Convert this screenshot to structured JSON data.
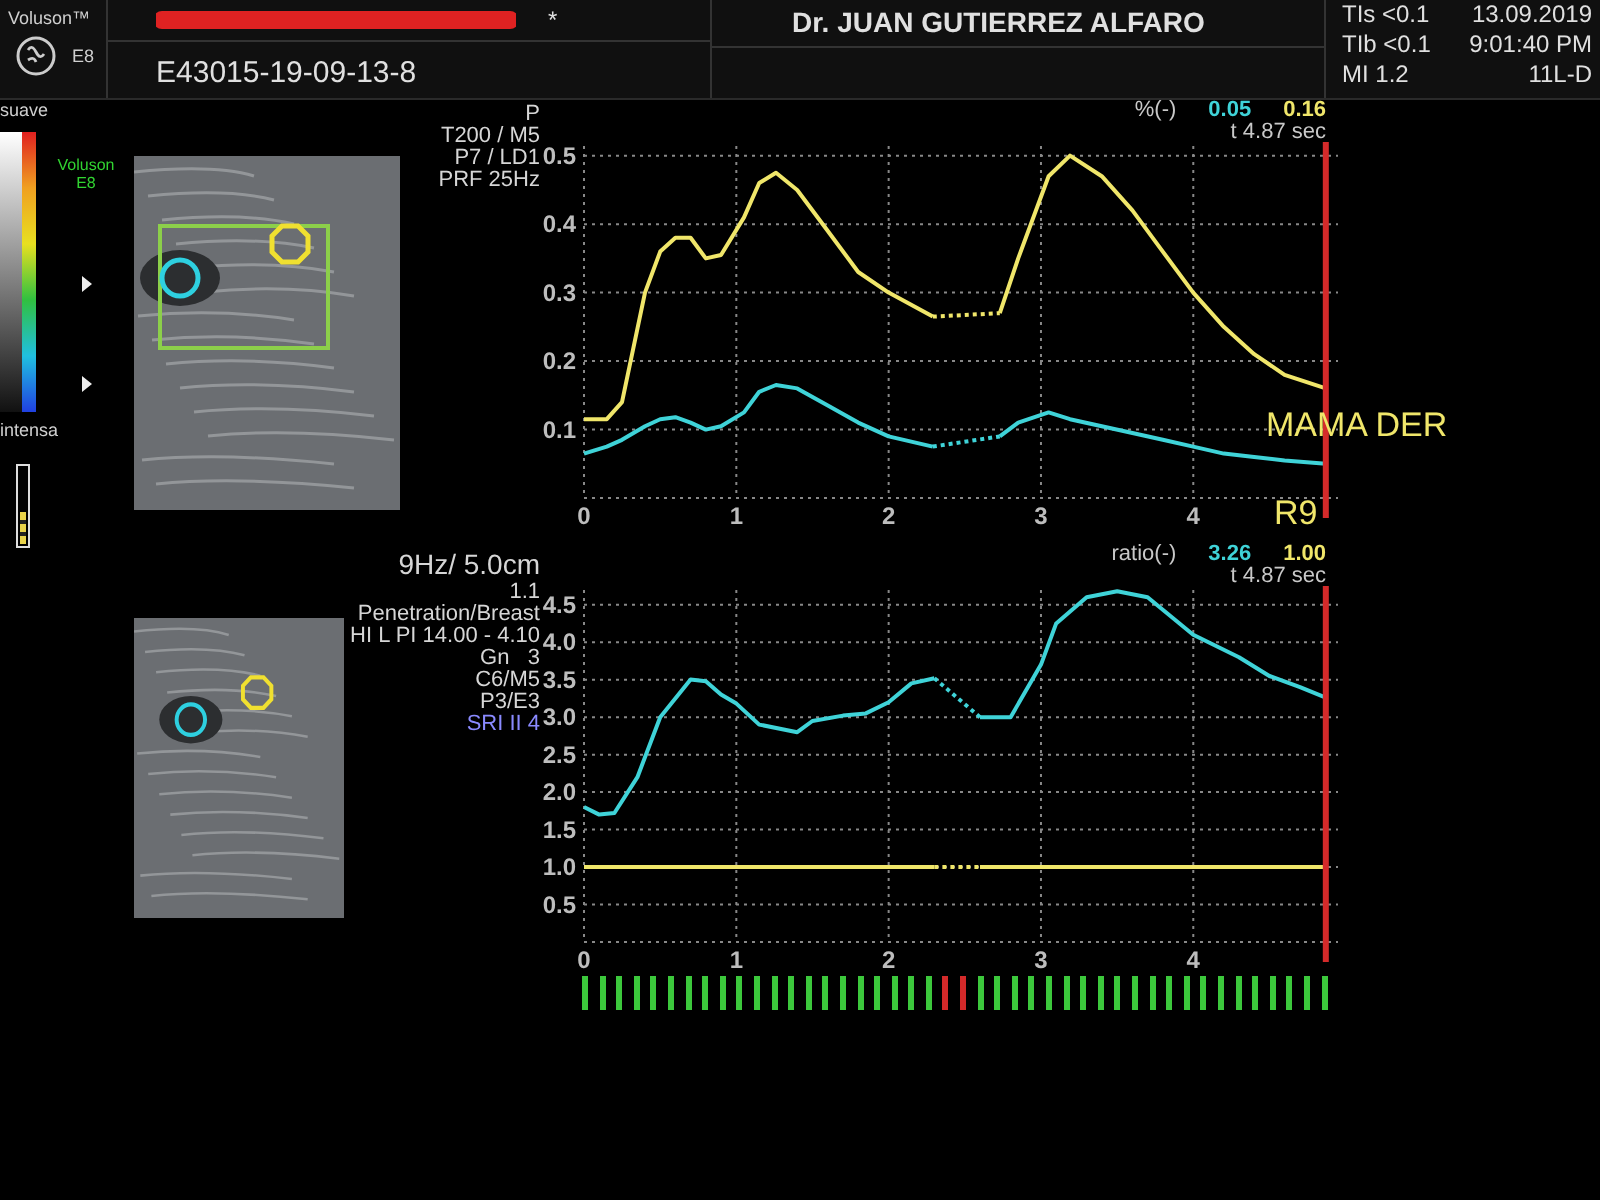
{
  "header": {
    "brand": "Voluson™",
    "model": "E8",
    "patient_flag": "*",
    "exam_id": "E43015-19-09-13-8",
    "doctor": "Dr. JUAN GUTIERREZ ALFARO",
    "safety": [
      "TIs <0.1",
      "TIb <0.1",
      "MI 1.2"
    ],
    "date": "13.09.2019",
    "time": "9:01:40 PM",
    "probe": "11L-D"
  },
  "color_scale": {
    "top_label": "suave",
    "bottom_label": "intensa",
    "brand_label": "Voluson",
    "model_label": "E8",
    "gauge": {
      "level": 0.4
    }
  },
  "panels": [
    {
      "image_params": [
        {
          "text": "P",
          "kind": "line",
          "color": "#d6d6d6"
        },
        {
          "text": "T200 / M5",
          "kind": "line",
          "color": "#d6d6d6"
        },
        {
          "text": "P7 / LD1",
          "kind": "line",
          "color": "#d6d6d6"
        },
        {
          "text": "PRF 25Hz",
          "kind": "line",
          "color": "#d6d6d6"
        }
      ],
      "readout": {
        "unit": "%(-)",
        "values": [
          {
            "text": "0.05",
            "color": "#3fd3d8"
          },
          {
            "text": "0.16",
            "color": "#f0e66a"
          }
        ],
        "time": "t 4.87 sec"
      },
      "labels": [
        {
          "text": "MAMA DER"
        },
        {
          "text": "R9"
        }
      ],
      "chart_data": {
        "type": "line",
        "x": [
          0,
          0.15,
          0.25,
          0.4,
          0.5,
          0.6,
          0.7,
          0.8,
          0.9,
          1.05,
          1.15,
          1.26,
          1.4,
          1.6,
          1.8,
          2.0,
          2.29,
          2.5,
          2.73,
          2.85,
          3.05,
          3.19,
          3.4,
          3.6,
          3.8,
          4.0,
          4.2,
          4.4,
          4.6,
          4.87
        ],
        "series": [
          {
            "color": "#f0e66a",
            "values": [
              0.115,
              0.115,
              0.14,
              0.3,
              0.36,
              0.38,
              0.38,
              0.35,
              0.355,
              0.41,
              0.46,
              0.475,
              0.45,
              0.39,
              0.33,
              0.3,
              0.265,
              null,
              0.27,
              0.35,
              0.47,
              0.5,
              0.47,
              0.42,
              0.36,
              0.3,
              0.25,
              0.21,
              0.18,
              0.16
            ]
          },
          {
            "color": "#3fd3d8",
            "values": [
              0.065,
              0.075,
              0.085,
              0.105,
              0.115,
              0.118,
              0.11,
              0.1,
              0.105,
              0.125,
              0.155,
              0.165,
              0.16,
              0.135,
              0.11,
              0.09,
              0.075,
              null,
              0.09,
              0.11,
              0.125,
              0.115,
              0.105,
              0.095,
              0.085,
              0.075,
              0.065,
              0.06,
              0.055,
              0.05
            ]
          }
        ],
        "xlim": [
          0,
          4.95
        ],
        "ylim": [
          0,
          0.52
        ],
        "xticks": [
          0,
          1,
          2,
          3,
          4
        ],
        "yticks": [
          0.1,
          0.2,
          0.3,
          0.4,
          0.5
        ],
        "grid": true,
        "ref_lines": [
          {
            "axis": "x",
            "value": 4.87,
            "color": "#d42a2a"
          }
        ]
      }
    },
    {
      "image_params": [
        {
          "text": "9Hz/ 5.0cm",
          "kind": "heading",
          "color": "#d6d6d6"
        },
        {
          "text": "1.1",
          "kind": "line",
          "color": "#d6d6d6"
        },
        {
          "text": "Penetration/Breast",
          "kind": "line",
          "color": "#d6d6d6"
        },
        {
          "text": "HI L PI 14.00 - 4.10",
          "kind": "line",
          "color": "#d6d6d6"
        },
        {
          "text": "Gn   3",
          "kind": "line",
          "color": "#d6d6d6"
        },
        {
          "text": "C6/M5",
          "kind": "line",
          "color": "#d6d6d6"
        },
        {
          "text": "P3/E3",
          "kind": "line",
          "color": "#d6d6d6"
        },
        {
          "text": "SRI II 4",
          "kind": "line",
          "color": "#8a8aff"
        }
      ],
      "readout": {
        "unit": "ratio(-)",
        "values": [
          {
            "text": "3.26",
            "color": "#3fd3d8"
          },
          {
            "text": "1.00",
            "color": "#f0e66a"
          }
        ],
        "time": "t 4.87 sec"
      },
      "chart_data": {
        "type": "line",
        "x": [
          0,
          0.1,
          0.2,
          0.35,
          0.5,
          0.7,
          0.8,
          0.9,
          1.0,
          1.15,
          1.4,
          1.5,
          1.7,
          1.85,
          2.0,
          2.15,
          2.3,
          2.45,
          2.6,
          2.8,
          3.0,
          3.1,
          3.3,
          3.5,
          3.7,
          4.0,
          4.3,
          4.5,
          4.7,
          4.87
        ],
        "series": [
          {
            "color": "#3fd3d8",
            "values": [
              1.8,
              1.7,
              1.72,
              2.2,
              3.0,
              3.5,
              3.48,
              3.3,
              3.18,
              2.9,
              2.8,
              2.95,
              3.02,
              3.05,
              3.2,
              3.45,
              3.52,
              null,
              3.0,
              3.0,
              3.7,
              4.25,
              4.6,
              4.68,
              4.6,
              4.1,
              3.8,
              3.55,
              3.4,
              3.26
            ]
          },
          {
            "color": "#f0e66a",
            "values": [
              1.0,
              1.0,
              1.0,
              1.0,
              1.0,
              1.0,
              1.0,
              1.0,
              1.0,
              1.0,
              1.0,
              1.0,
              1.0,
              1.0,
              1.0,
              1.0,
              1.0,
              null,
              1.0,
              1.0,
              1.0,
              1.0,
              1.0,
              1.0,
              1.0,
              1.0,
              1.0,
              1.0,
              1.0,
              1.0
            ]
          }
        ],
        "xlim": [
          0,
          4.95
        ],
        "ylim": [
          0,
          4.75
        ],
        "xticks": [
          0,
          1,
          2,
          3,
          4
        ],
        "yticks": [
          {
            "value": 0.5,
            "label": "0.5"
          },
          {
            "value": 1,
            "label": "1.0"
          },
          {
            "value": 1.5,
            "label": "1.5"
          },
          {
            "value": 2,
            "label": "2.0"
          },
          {
            "value": 2.5,
            "label": "2.5"
          },
          {
            "value": 3,
            "label": "3.0"
          },
          {
            "value": 3.5,
            "label": "3.5"
          },
          {
            "value": 4,
            "label": "4.0"
          },
          {
            "value": 4.5,
            "label": "4.5"
          }
        ],
        "grid": true,
        "ref_lines": [
          {
            "axis": "x",
            "value": 4.87,
            "color": "#d42a2a"
          }
        ]
      }
    }
  ],
  "frame_markers": [
    {
      "color": "#3cc83c"
    },
    {
      "color": "#3cc83c"
    },
    {
      "color": "#3cc83c"
    },
    {
      "color": "#3cc83c"
    },
    {
      "color": "#3cc83c"
    },
    {
      "color": "#3cc83c"
    },
    {
      "color": "#3cc83c"
    },
    {
      "color": "#3cc83c"
    },
    {
      "color": "#3cc83c"
    },
    {
      "color": "#3cc83c"
    },
    {
      "color": "#3cc83c"
    },
    {
      "color": "#3cc83c"
    },
    {
      "color": "#3cc83c"
    },
    {
      "color": "#3cc83c"
    },
    {
      "color": "#3cc83c"
    },
    {
      "color": "#3cc83c"
    },
    {
      "color": "#3cc83c"
    },
    {
      "color": "#3cc83c"
    },
    {
      "color": "#3cc83c"
    },
    {
      "color": "#3cc83c"
    },
    {
      "color": "#3cc83c"
    },
    {
      "color": "#d42a2a"
    },
    {
      "color": "#d42a2a"
    },
    {
      "color": "#3cc83c"
    },
    {
      "color": "#3cc83c"
    },
    {
      "color": "#3cc83c"
    },
    {
      "color": "#3cc83c"
    },
    {
      "color": "#3cc83c"
    },
    {
      "color": "#3cc83c"
    },
    {
      "color": "#3cc83c"
    },
    {
      "color": "#3cc83c"
    },
    {
      "color": "#3cc83c"
    },
    {
      "color": "#3cc83c"
    },
    {
      "color": "#3cc83c"
    },
    {
      "color": "#3cc83c"
    },
    {
      "color": "#3cc83c"
    },
    {
      "color": "#3cc83c"
    },
    {
      "color": "#3cc83c"
    },
    {
      "color": "#3cc83c"
    },
    {
      "color": "#3cc83c"
    },
    {
      "color": "#3cc83c"
    },
    {
      "color": "#3cc83c"
    },
    {
      "color": "#3cc83c"
    },
    {
      "color": "#3cc83c"
    }
  ]
}
